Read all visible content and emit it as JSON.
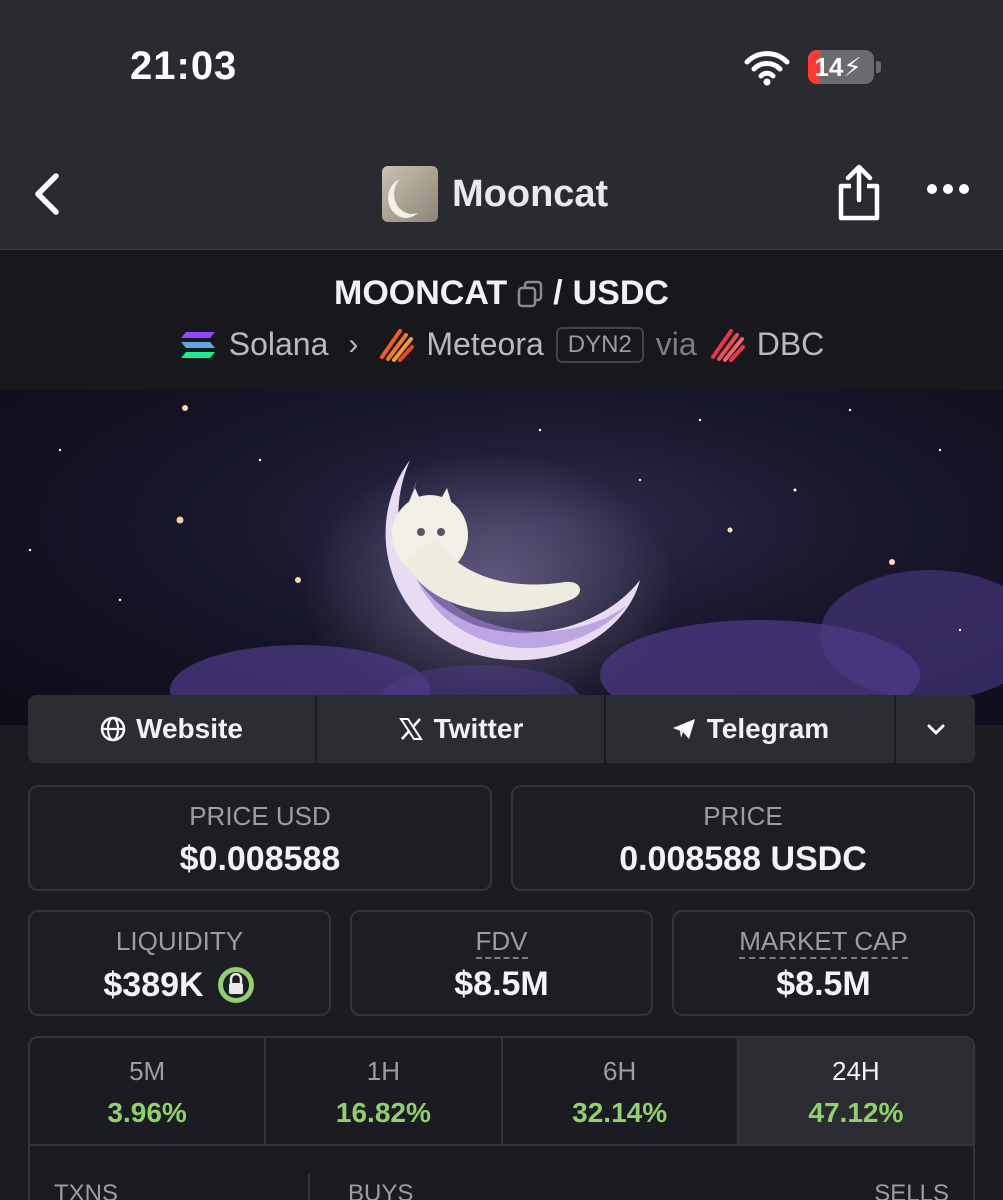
{
  "status_bar": {
    "time": "21:03",
    "battery": "14"
  },
  "nav": {
    "title": "Mooncat"
  },
  "pair": {
    "base": "MOONCAT",
    "separator": "/",
    "quote": "USDC",
    "chain": "Solana",
    "dex": "Meteora",
    "dex_badge": "DYN2",
    "via_label": "via",
    "via_source": "DBC"
  },
  "social": {
    "website": "Website",
    "twitter": "Twitter",
    "telegram": "Telegram"
  },
  "stats": {
    "price_usd_label": "PRICE USD",
    "price_usd": "$0.008588",
    "price_label": "PRICE",
    "price": "0.008588 USDC",
    "liquidity_label": "LIQUIDITY",
    "liquidity": "$389K",
    "fdv_label": "FDV",
    "fdv": "$8.5M",
    "mcap_label": "MARKET CAP",
    "mcap": "$8.5M"
  },
  "timeframes": [
    {
      "label": "5M",
      "change": "3.96%"
    },
    {
      "label": "1H",
      "change": "16.82%"
    },
    {
      "label": "6H",
      "change": "32.14%"
    },
    {
      "label": "24H",
      "change": "47.12%"
    }
  ],
  "txn_header": {
    "txns": "TXNS",
    "buys": "BUYS",
    "sells": "SELLS"
  },
  "colors": {
    "positive": "#8fd16a",
    "battery_low": "#ff3b30"
  }
}
